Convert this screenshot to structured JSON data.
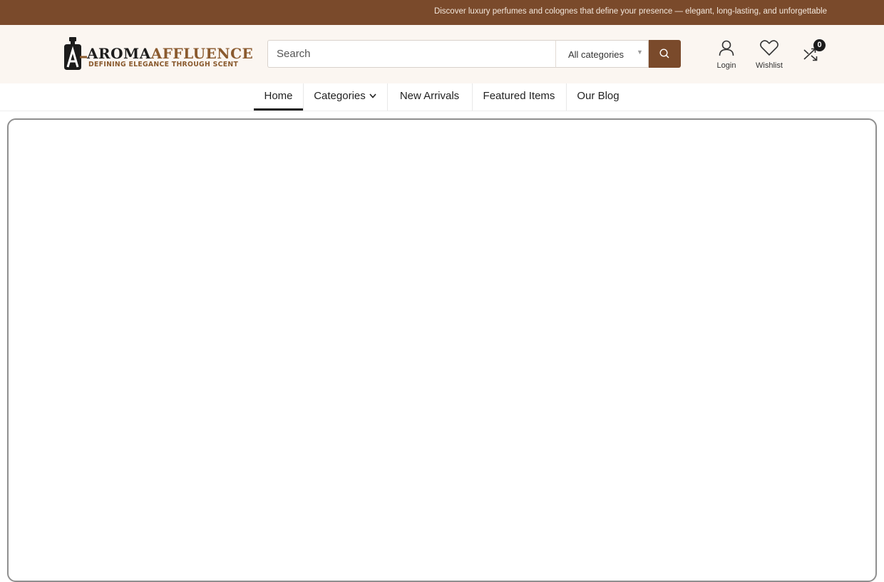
{
  "topbar": {
    "announcement": "Discover luxury perfumes and colognes that define your presence — elegant, long-lasting, and unforgettable",
    "background": "#7a4a2b"
  },
  "logo": {
    "title_dark": "AROMA",
    "title_brown": "AFFLUENCE",
    "tagline": "DEFINING ELEGANCE THROUGH SCENT",
    "brand_color": "#8a5a2e"
  },
  "search": {
    "placeholder": "Search",
    "category_selected": "All categories",
    "button_icon": "search-icon"
  },
  "header_icons": {
    "login_label": "Login",
    "wishlist_label": "Wishlist",
    "compare_count": "0"
  },
  "nav": {
    "items": [
      {
        "label": "Home",
        "active": true
      },
      {
        "label": "Categories",
        "has_dropdown": true
      },
      {
        "label": "New Arrivals"
      },
      {
        "label": "Featured Items"
      },
      {
        "label": "Our Blog"
      }
    ]
  }
}
